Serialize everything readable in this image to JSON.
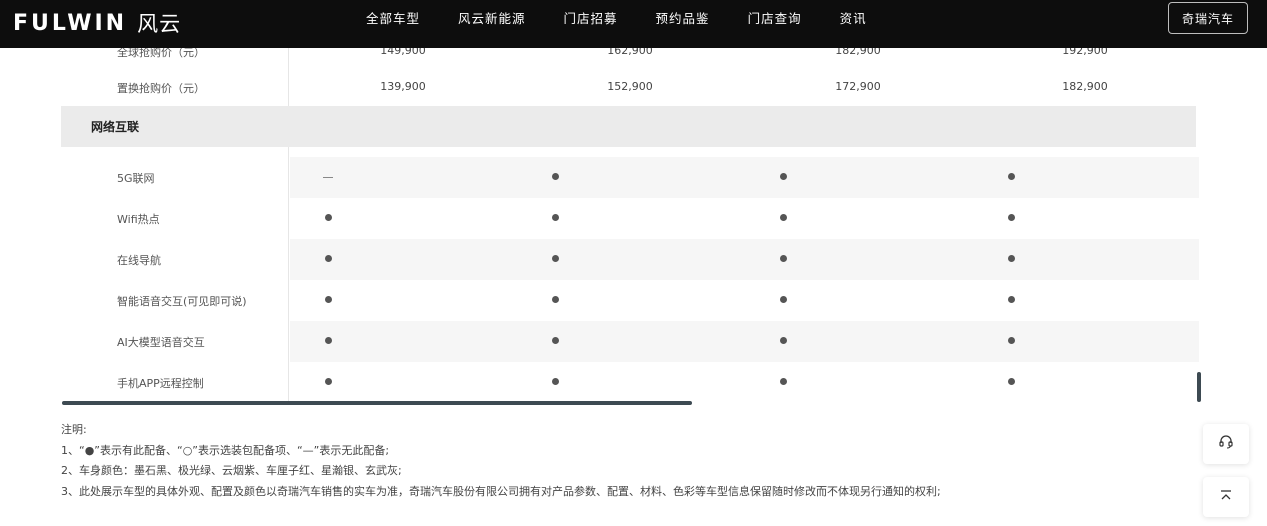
{
  "header": {
    "logo_word": "FULWIN",
    "logo_cn": "风云",
    "nav": [
      "全部车型",
      "风云新能源",
      "门店招募",
      "预约品鉴",
      "门店查询",
      "资讯"
    ],
    "brand_button": "奇瑞汽车"
  },
  "table": {
    "partial_row": {
      "label": "全球抢购价（元）",
      "values": [
        "149,900",
        "162,900",
        "182,900",
        "192,900"
      ]
    },
    "price_row": {
      "label": "置换抢购价（元）",
      "values": [
        "139,900",
        "152,900",
        "172,900",
        "182,900"
      ]
    },
    "section_title": "网络互联",
    "feature_rows": [
      {
        "label": "5G联网",
        "cells": [
          "dash",
          "dot",
          "dot",
          "dot"
        ]
      },
      {
        "label": "Wifi热点",
        "cells": [
          "dot",
          "dot",
          "dot",
          "dot"
        ]
      },
      {
        "label": "在线导航",
        "cells": [
          "dot",
          "dot",
          "dot",
          "dot"
        ]
      },
      {
        "label": "智能语音交互(可见即可说)",
        "cells": [
          "dot",
          "dot",
          "dot",
          "dot"
        ]
      },
      {
        "label": "AI大模型语音交互",
        "cells": [
          "dot",
          "dot",
          "dot",
          "dot"
        ]
      },
      {
        "label": "手机APP远程控制",
        "cells": [
          "dot",
          "dot",
          "dot",
          "dot"
        ]
      }
    ]
  },
  "notes": {
    "title": "注明:",
    "lines": [
      "1、“●”表示有此配备、“○”表示选装包配备项、“—”表示无此配备;",
      "2、车身颜色：墨石黑、极光绿、云烟紫、车厘子红、星瀚银、玄武灰;",
      "3、此处展示车型的具体外观、配置及颜色以奇瑞汽车销售的实车为准，奇瑞汽车股份有限公司拥有对产品参数、配置、材料、色彩等车型信息保留随时修改而不体现另行通知的权利;"
    ]
  },
  "floating": {
    "service_icon": "headset-icon",
    "top_icon": "back-to-top-icon"
  },
  "colors": {
    "header_bg": "#0d0d0d",
    "section_bg": "#ebebeb",
    "scrollbar": "#3d4a52"
  }
}
